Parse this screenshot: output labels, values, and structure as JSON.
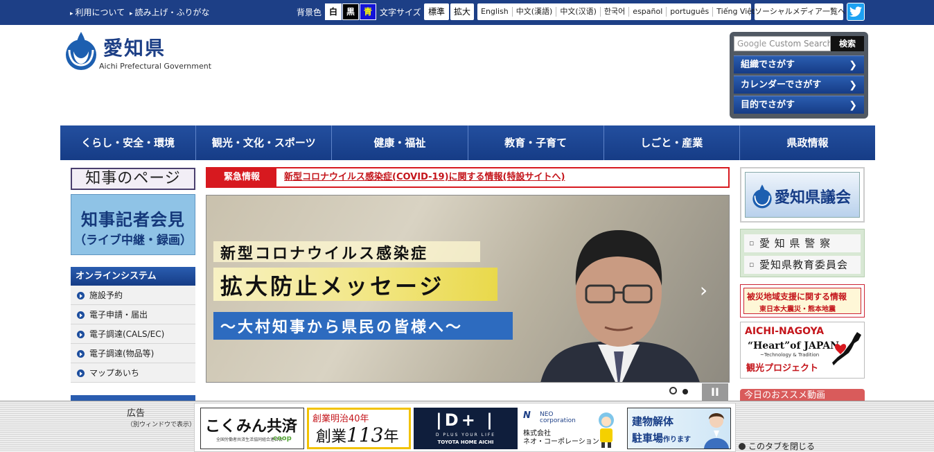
{
  "topbar": {
    "about": "利用について",
    "reading": "読み上げ・ふりがな",
    "bg_label": "背景色",
    "bg_white": "白",
    "bg_black": "黒",
    "bg_blue": "青",
    "size_label": "文字サイズ",
    "size_normal": "標準",
    "size_large": "拡大",
    "languages": [
      "English",
      "中文(漢語)",
      "中文(汉语)",
      "한국어",
      "español",
      "português",
      "Tiếng Việt"
    ],
    "social_list": "ソーシャルメディア一覧へ",
    "twitter_icon": "twitter-icon"
  },
  "logo": {
    "name": "愛知県",
    "english": "Aichi Prefectural Government"
  },
  "search": {
    "placeholder_google": "Google",
    "placeholder": "Custom Search",
    "button": "検索",
    "items": [
      "組織でさがす",
      "カレンダーでさがす",
      "目的でさがす"
    ]
  },
  "global_nav": [
    "くらし・安全・環境",
    "観光・文化・スポーツ",
    "健康・福祉",
    "教育・子育て",
    "しごと・産業",
    "県政情報"
  ],
  "left": {
    "governor_page": "知事のページ",
    "press_conf_line1": "知事記者会見",
    "press_conf_line2": "（ライブ中継・録画）",
    "online_title": "オンラインシステム",
    "online_items": [
      "施設予約",
      "電子申請・届出",
      "電子調達(CALS/EC)",
      "電子調達(物品等)",
      "マップあいち"
    ]
  },
  "emergency": {
    "label": "緊急情報",
    "text": "新型コロナウイルス感染症(COVID-19)に関する情報(特設サイトへ)"
  },
  "slide": {
    "caption1": "新型コロナウイルス感染症",
    "caption2": "拡大防止メッセージ",
    "caption3": "～大村知事から県民の皆様へ～",
    "pause": "II"
  },
  "right": {
    "assembly": "愛知県議会",
    "police": "愛 知 県 警 察",
    "education": "愛知県教育委員会",
    "disaster_line1": "被災地域支援に関する情報",
    "disaster_line2": "東日本大震災・熊本地震",
    "heart_line1": "AICHI-NAGOYA",
    "heart_line2": "“Heart”of JAPAN",
    "heart_line3": "~Technology & Tradition",
    "heart_line4": "観光プロジェクト",
    "recommended": "今日のおススメ動画"
  },
  "ads": {
    "label": "広告",
    "sublabel": "（別ウィンドウで表示）",
    "ad1_main": "こくみん共済",
    "ad1_sub": "全国労働者共済生活協同組合連合会",
    "ad1_coop": "coop",
    "ad2_line1": "創業明治40年",
    "ad2_prefix": "創業",
    "ad2_num": "113",
    "ad2_suffix": "年",
    "ad3_main": "|D+ |",
    "ad3_sub": "D PLUS YOUR LIFE",
    "ad3_company": "TOYOTA HOME AICHI",
    "ad4_logo": "N",
    "ad4_brand": "NEO\ncorporation",
    "ad4_line1": "株式会社",
    "ad4_line2": "ネオ・コーポレーション",
    "ad5_line1": "建物解体",
    "ad5_line2": "駐車場",
    "ad5_line2b": "作ります",
    "close_tab": "このタブを閉じる"
  },
  "colors": {
    "navy": "#1d3f86",
    "emergency_red": "#d7191f",
    "twitter": "#1da1f2"
  }
}
